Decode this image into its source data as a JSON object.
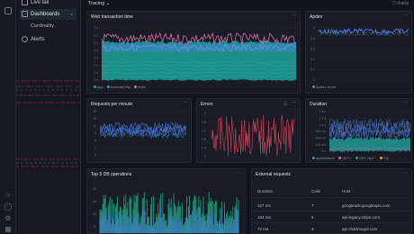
{
  "sidebar": {
    "live_tail": "Live tail",
    "dashboards": "Dashboards",
    "cardinality": "Cardinality",
    "alerts": "Alerts"
  },
  "header": {
    "tab_label": "Tracing",
    "charts_count": "7 charts"
  },
  "cards": {
    "web_transaction": {
      "title": "Web transaction time",
      "legend": [
        "app",
        "external-http",
        "redis"
      ],
      "y_ticks": [
        "7 s",
        "6 s",
        "5 s",
        "4 s",
        "3 s",
        "2 s",
        "1 s",
        "0 s"
      ]
    },
    "apdex": {
      "title": "Apdex",
      "legend": [
        "Apdex score"
      ],
      "y_ticks": [
        "1",
        "0.8",
        "0.6",
        "0.4",
        "0.2",
        "0"
      ]
    },
    "requests_per_minute": {
      "title": "Requests per minute",
      "y_ticks": [
        "18",
        "15",
        "12",
        "9",
        "6",
        "3",
        "0"
      ]
    },
    "errors": {
      "title": "Errors",
      "y_ticks": [
        "2",
        "1.6",
        "1.2",
        "0.8",
        "0.4",
        "0"
      ]
    },
    "duration": {
      "title": "Duration",
      "legend": [
        "applications",
        "GET /",
        "GET /api/..",
        "SQ"
      ],
      "y_ticks": [
        "1.8 s",
        "1.5 s",
        "1.2 s",
        "900 ms",
        "600 ms",
        "300 ms",
        "0 s"
      ]
    },
    "top_db": {
      "title": "Top 5 DB operations",
      "y_ticks": [
        "40",
        "30",
        "20",
        "10"
      ]
    },
    "external_requests": {
      "title": "External requests",
      "columns": [
        "Duration",
        "Calls",
        "Host"
      ],
      "rows": [
        [
          "327 ms",
          "7",
          "googleads.googleapis.com"
        ],
        [
          "184 ms",
          "5",
          "api-legacy.stripe.com"
        ],
        [
          "72 ms",
          "8",
          "api.chartmogul.com"
        ]
      ]
    }
  },
  "colors": {
    "bg": "#12141b",
    "card": "#191c25",
    "blue": "#4f7fe6",
    "pink": "#d46ab0",
    "teal": "#1fa39a",
    "red": "#e0475f",
    "green": "#1fbf8f"
  }
}
